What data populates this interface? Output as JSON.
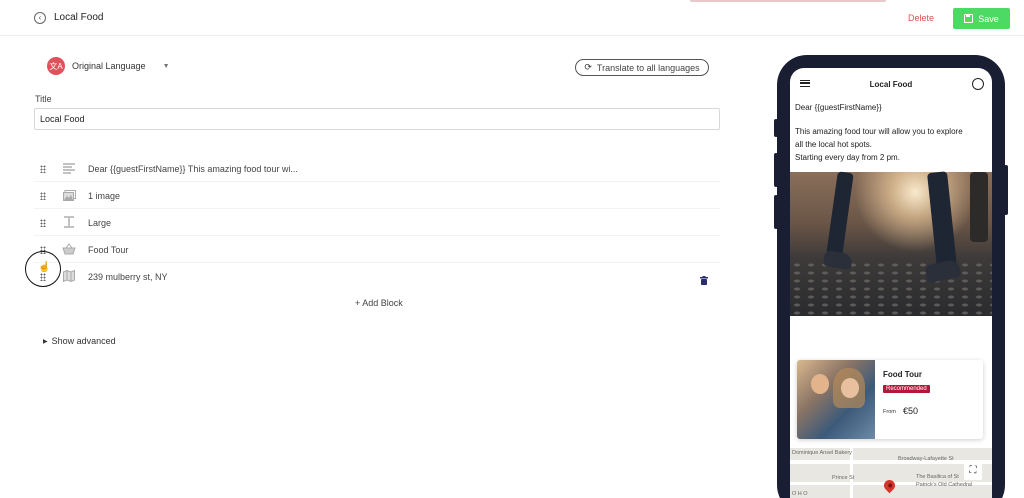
{
  "header": {
    "title": "Local Food",
    "delete_label": "Delete",
    "save_label": "Save"
  },
  "language": {
    "label": "Original Language",
    "translate_label": "Translate to all languages"
  },
  "title_field": {
    "label": "Title",
    "value": "Local Food"
  },
  "blocks": [
    {
      "type_icon": "text-lines-icon",
      "text": "Dear {{guestFirstName}} This amazing food tour wi..."
    },
    {
      "type_icon": "image-icon",
      "text": "1 image"
    },
    {
      "type_icon": "spacer-icon",
      "text": "Large"
    },
    {
      "type_icon": "basket-icon",
      "text": "Food Tour"
    },
    {
      "type_icon": "map-icon",
      "text": "239 mulberry st, NY"
    }
  ],
  "add_block_label": "+ Add Block",
  "show_advanced_label": "Show advanced",
  "preview": {
    "nav_title": "Local Food",
    "greeting": "Dear {{guestFirstName}}",
    "body_line1": "This amazing food tour will allow you to explore",
    "body_line2": "all the local hot spots.",
    "body_line3": "Starting every day from 2 pm.",
    "card": {
      "title": "Food Tour",
      "badge": "Recommended",
      "from_label": "From",
      "price": "€50"
    },
    "map_labels": {
      "bakery": "Dominique Ansel Bakery",
      "station": "Broadway-Lafayette St",
      "prince": "Prince St",
      "basilica1": "The Basilica of St",
      "basilica2": "Patrick's Old Cathedral",
      "soho": "O H O"
    }
  },
  "colors": {
    "save": "#4cd964",
    "delete": "#d9534f",
    "lang_icon": "#e0525b",
    "phone_frame": "#1a1e33",
    "badge": "#b2183a"
  }
}
